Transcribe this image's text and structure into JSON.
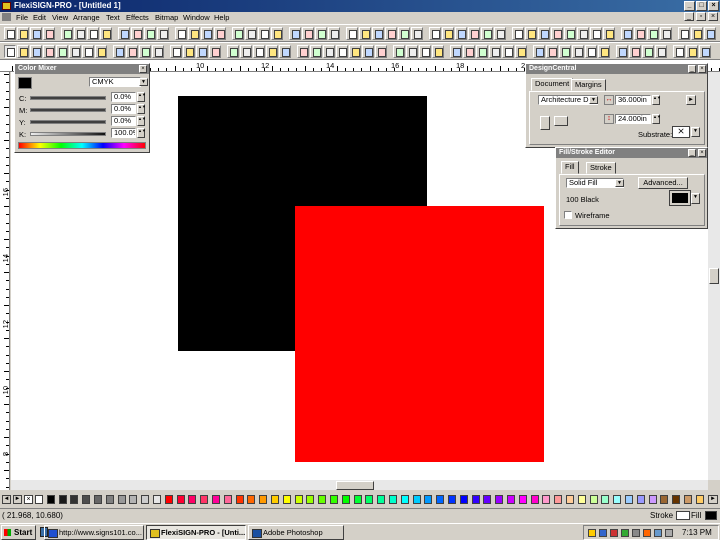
{
  "window": {
    "title": "FlexiSIGN-PRO - [Untitled 1]",
    "controls": [
      "_",
      "□",
      "×"
    ]
  },
  "menu": [
    "File",
    "Edit",
    "View",
    "Arrange",
    "Text",
    "Effects",
    "Bitmap",
    "Window",
    "Help"
  ],
  "ruler_top_labels": [
    "10",
    "12",
    "14",
    "16",
    "18",
    "20"
  ],
  "ruler_left_labels": [
    "16",
    "14",
    "12",
    "10",
    "8"
  ],
  "color_mixer": {
    "title": "Color Mixer",
    "mode": "CMYK",
    "channels": [
      {
        "label": "C:",
        "value": "0.0%"
      },
      {
        "label": "M:",
        "value": "0.0%"
      },
      {
        "label": "Y:",
        "value": "0.0%"
      },
      {
        "label": "K:",
        "value": "100.0%"
      }
    ],
    "swatch_color": "#000000"
  },
  "design_central": {
    "title": "DesignCentral",
    "tabs": [
      "Document",
      "Margins"
    ],
    "media": "Architecture D",
    "width": "36.000in",
    "height": "24.000in",
    "substrate_label": "Substrate:"
  },
  "fill_stroke": {
    "title": "Fill/Stroke Editor",
    "tabs": [
      "Fill",
      "Stroke"
    ],
    "fill_type": "Solid Fill",
    "advanced_label": "Advanced...",
    "color_name": "100 Black",
    "wireframe_label": "Wireframe"
  },
  "canvas_objects": [
    {
      "name": "black-rectangle",
      "color": "#000000"
    },
    {
      "name": "red-rectangle",
      "color": "#ff0000"
    }
  ],
  "status": {
    "coords": "(   21.968,    10.680)",
    "stroke_label": "Stroke",
    "fill_label": "Fill"
  },
  "taskbar": {
    "start_label": "Start",
    "tasks": [
      {
        "label": "http://www.signs101.co...",
        "active": false
      },
      {
        "label": "FlexiSIGN-PRO - [Unti...",
        "active": true
      },
      {
        "label": "Adobe Photoshop",
        "active": false
      }
    ],
    "clock": "7:13 PM"
  },
  "palette_colors": [
    "#ffffff",
    "#000000",
    "#1a1a1a",
    "#333333",
    "#4d4d4d",
    "#666666",
    "#808080",
    "#999999",
    "#b3b3b3",
    "#cccccc",
    "#e6e6e6",
    "#ff0000",
    "#ff0033",
    "#ff0066",
    "#ff3366",
    "#ff0099",
    "#ff6699",
    "#ff3300",
    "#ff6600",
    "#ff9900",
    "#ffcc00",
    "#ffff00",
    "#ccff00",
    "#99ff00",
    "#66ff00",
    "#33ff00",
    "#00ff00",
    "#00ff33",
    "#00ff66",
    "#00ff99",
    "#00ffcc",
    "#00ffff",
    "#00ccff",
    "#0099ff",
    "#0066ff",
    "#0033ff",
    "#0000ff",
    "#3300ff",
    "#6600ff",
    "#9900ff",
    "#cc00ff",
    "#ff00ff",
    "#ff00cc",
    "#ff99cc",
    "#ff9999",
    "#ffcc99",
    "#ffff99",
    "#ccff99",
    "#99ffcc",
    "#99ffff",
    "#99ccff",
    "#9999ff",
    "#cc99ff",
    "#996633",
    "#663300",
    "#cc9966",
    "#ffcc66"
  ]
}
